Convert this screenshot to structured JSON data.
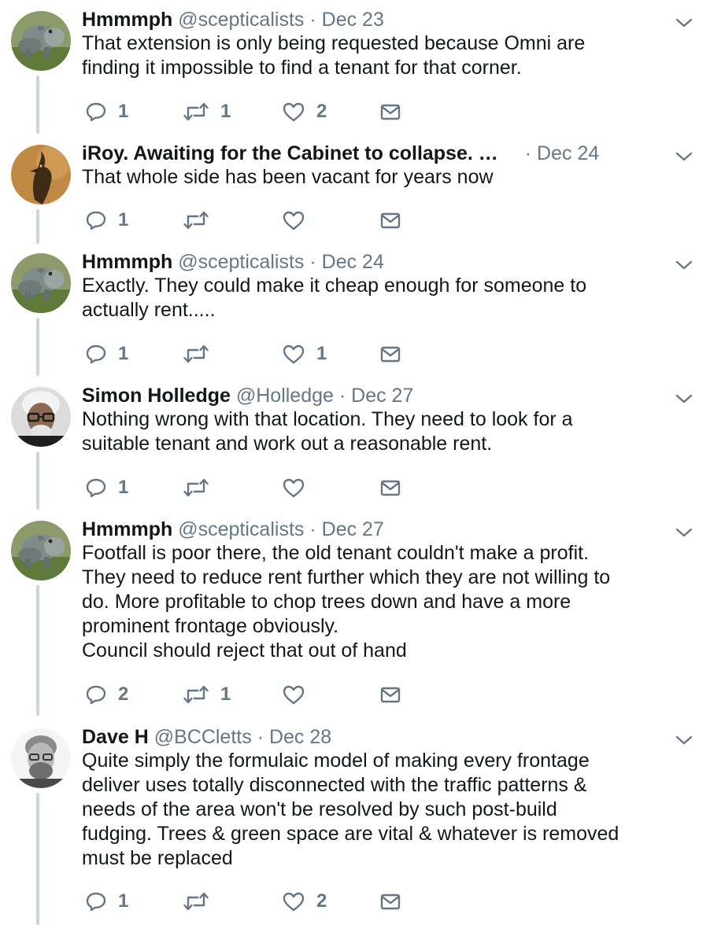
{
  "tweets": [
    {
      "name": "Hmmmph",
      "handle": "@scepticalists",
      "separator": "·",
      "date": "Dec 23",
      "text": "That extension is only being requested because Omni are\nfinding it impossible to find a tenant for that corner.",
      "replies": "1",
      "retweets": "1",
      "likes": "2",
      "avatar": "hippo"
    },
    {
      "name": "iRoy. Awaiting for the Cabinet to collapse. …",
      "handle": "",
      "separator": "·",
      "date": "Dec 24",
      "text": "That whole side has been vacant for years now",
      "replies": "1",
      "retweets": "",
      "likes": "",
      "avatar": "bird"
    },
    {
      "name": "Hmmmph",
      "handle": "@scepticalists",
      "separator": "·",
      "date": "Dec 24",
      "text": "Exactly. They could make it cheap enough for someone to\nactually rent.....",
      "replies": "1",
      "retweets": "",
      "likes": "1",
      "avatar": "hippo"
    },
    {
      "name": "Simon Holledge",
      "handle": "@Holledge",
      "separator": "·",
      "date": "Dec 27",
      "text": "Nothing wrong with that location. They need to look for a\nsuitable tenant and work out a reasonable rent.",
      "replies": "1",
      "retweets": "",
      "likes": "",
      "avatar": "man-glasses"
    },
    {
      "name": "Hmmmph",
      "handle": "@scepticalists",
      "separator": "·",
      "date": "Dec 27",
      "text": "Footfall is poor there, the old tenant couldn't make a profit.\nThey need to reduce rent further which they are not willing to\ndo. More profitable to chop trees down and have a more\nprominent frontage obviously.\nCouncil should reject that out of hand",
      "replies": "2",
      "retweets": "1",
      "likes": "",
      "avatar": "hippo"
    },
    {
      "name": "Dave H",
      "handle": "@BCCletts",
      "separator": "·",
      "date": "Dec 28",
      "text": "Quite simply the formulaic model of making every frontage\ndeliver uses totally disconnected with the traffic patterns &\nneeds of the area won't be resolved by such post-build\nfudging. Trees & green space are vital & whatever is removed\nmust be replaced",
      "replies": "1",
      "retweets": "",
      "likes": "2",
      "avatar": "man-beard"
    }
  ],
  "icons": {
    "reply": "reply-icon",
    "retweet": "retweet-icon",
    "like": "heart-icon",
    "message": "envelope-icon",
    "more": "chevron-down-icon"
  },
  "colors": {
    "text": "#14171a",
    "secondary": "#657786",
    "thread_line": "#ccd6dd"
  }
}
